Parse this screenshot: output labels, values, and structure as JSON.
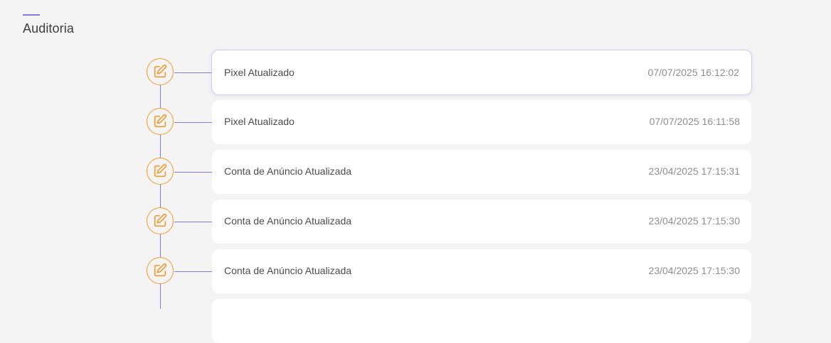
{
  "header": {
    "title": "Auditoria"
  },
  "colors": {
    "accent": "#8479dc",
    "icon": "#f39a2f",
    "background": "#f4f4f4",
    "card": "#ffffff"
  },
  "audit": {
    "entries": [
      {
        "label": "Pixel Atualizado",
        "timestamp": "07/07/2025 16:12:02",
        "icon": "edit-icon"
      },
      {
        "label": "Pixel Atualizado",
        "timestamp": "07/07/2025 16:11:58",
        "icon": "edit-icon"
      },
      {
        "label": "Conta de Anúncio Atualizada",
        "timestamp": "23/04/2025 17:15:31",
        "icon": "edit-icon"
      },
      {
        "label": "Conta de Anúncio Atualizada",
        "timestamp": "23/04/2025 17:15:30",
        "icon": "edit-icon"
      },
      {
        "label": "Conta de Anúncio Atualizada",
        "timestamp": "23/04/2025 17:15:30",
        "icon": "edit-icon"
      }
    ]
  }
}
